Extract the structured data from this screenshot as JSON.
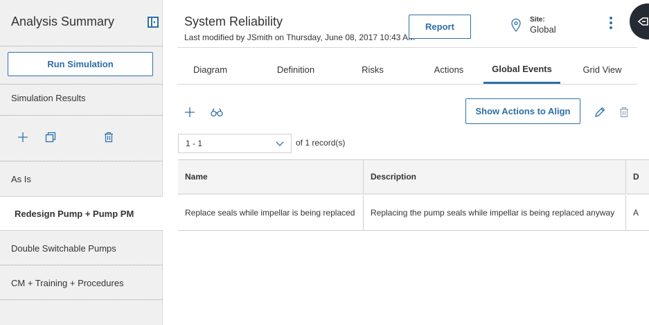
{
  "sidebar": {
    "title": "Analysis Summary",
    "run_button": "Run Simulation",
    "results_label": "Simulation Results",
    "tools": [
      "add-icon",
      "copy-icon",
      "trash-icon"
    ],
    "items": [
      {
        "label": "As Is"
      },
      {
        "label": "Redesign Pump + Pump PM"
      },
      {
        "label": "Double Switchable Pumps"
      },
      {
        "label": "CM + Training + Procedures"
      }
    ],
    "active_item": "Redesign Pump + Pump PM"
  },
  "header": {
    "title": "System Reliability",
    "subtitle": "Last modified by JSmith on Thursday, June 08, 2017 10:43 AM",
    "report_button": "Report",
    "site_label": "Site:",
    "site_value": "Global"
  },
  "tabs": [
    {
      "label": "Diagram"
    },
    {
      "label": "Definition"
    },
    {
      "label": "Risks"
    },
    {
      "label": "Actions"
    },
    {
      "label": "Global Events"
    },
    {
      "label": "Grid View"
    }
  ],
  "active_tab": "Global Events",
  "toolbar": {
    "align_button": "Show Actions to Align"
  },
  "pager": {
    "range": "1 - 1",
    "of": "of",
    "count": "1",
    "records": "record(s)"
  },
  "table": {
    "columns": [
      "Name",
      "Description",
      "D"
    ],
    "rows": [
      [
        "Replace seals while impellar is being replaced",
        "Replacing the pump seals while impellar is being replaced anyway",
        "A"
      ]
    ]
  },
  "colors": {
    "accent": "#2d6fa8",
    "sidebar_bg": "#f0f0f0",
    "corner_button": "#252b33"
  }
}
